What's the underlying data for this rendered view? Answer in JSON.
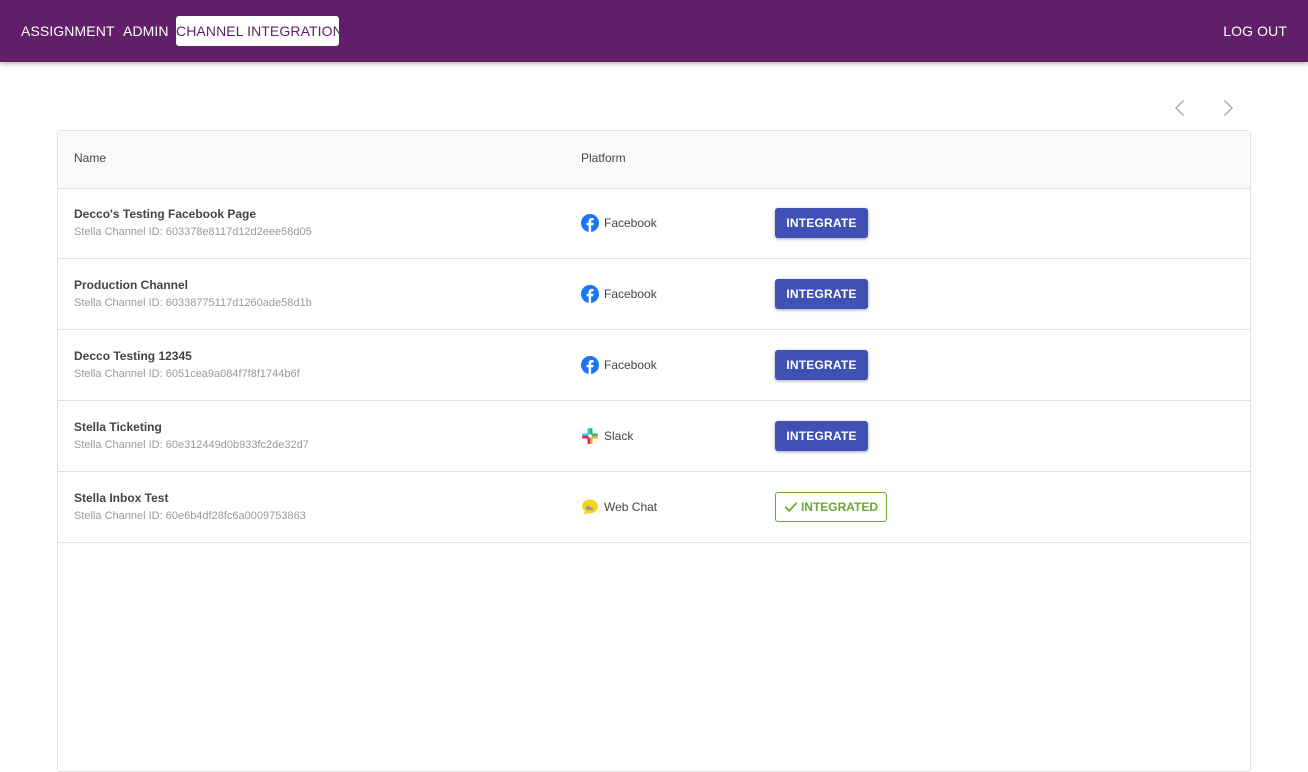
{
  "nav": {
    "items": [
      {
        "label": "ASSIGNMENT",
        "active": false
      },
      {
        "label": "ADMIN",
        "active": false
      },
      {
        "label": "CHANNEL INTEGRATION",
        "active": true
      }
    ],
    "logout_label": "LOG OUT"
  },
  "colors": {
    "appbar": "#611f69",
    "primary_button": "#3f51b5",
    "integrated": "#6aab2f",
    "facebook": "#1877f2",
    "webchat": "#f7d21e"
  },
  "pagination": {
    "prev_icon": "chevron-left-icon",
    "next_icon": "chevron-right-icon"
  },
  "table": {
    "columns": [
      "Name",
      "Platform",
      ""
    ],
    "rows": [
      {
        "name": "Decco's Testing Facebook Page",
        "channel_id": "Stella Channel ID: 603378e8117d12d2eee58d05",
        "platform": "Facebook",
        "platform_icon": "facebook-icon",
        "action": "INTEGRATE",
        "integrated": false
      },
      {
        "name": "Production Channel",
        "channel_id": "Stella Channel ID: 60338775117d1260ade58d1b",
        "platform": "Facebook",
        "platform_icon": "facebook-icon",
        "action": "INTEGRATE",
        "integrated": false
      },
      {
        "name": "Decco Testing 12345",
        "channel_id": "Stella Channel ID: 6051cea9a084f7f8f1744b6f",
        "platform": "Facebook",
        "platform_icon": "facebook-icon",
        "action": "INTEGRATE",
        "integrated": false
      },
      {
        "name": "Stella Ticketing",
        "channel_id": "Stella Channel ID: 60e312449d0b933fc2de32d7",
        "platform": "Slack",
        "platform_icon": "slack-icon",
        "action": "INTEGRATE",
        "integrated": false
      },
      {
        "name": "Stella Inbox Test",
        "channel_id": "Stella Channel ID: 60e6b4df28fc6a0009753863",
        "platform": "Web Chat",
        "platform_icon": "web-chat-icon",
        "action": "INTEGRATED",
        "integrated": true
      }
    ]
  }
}
